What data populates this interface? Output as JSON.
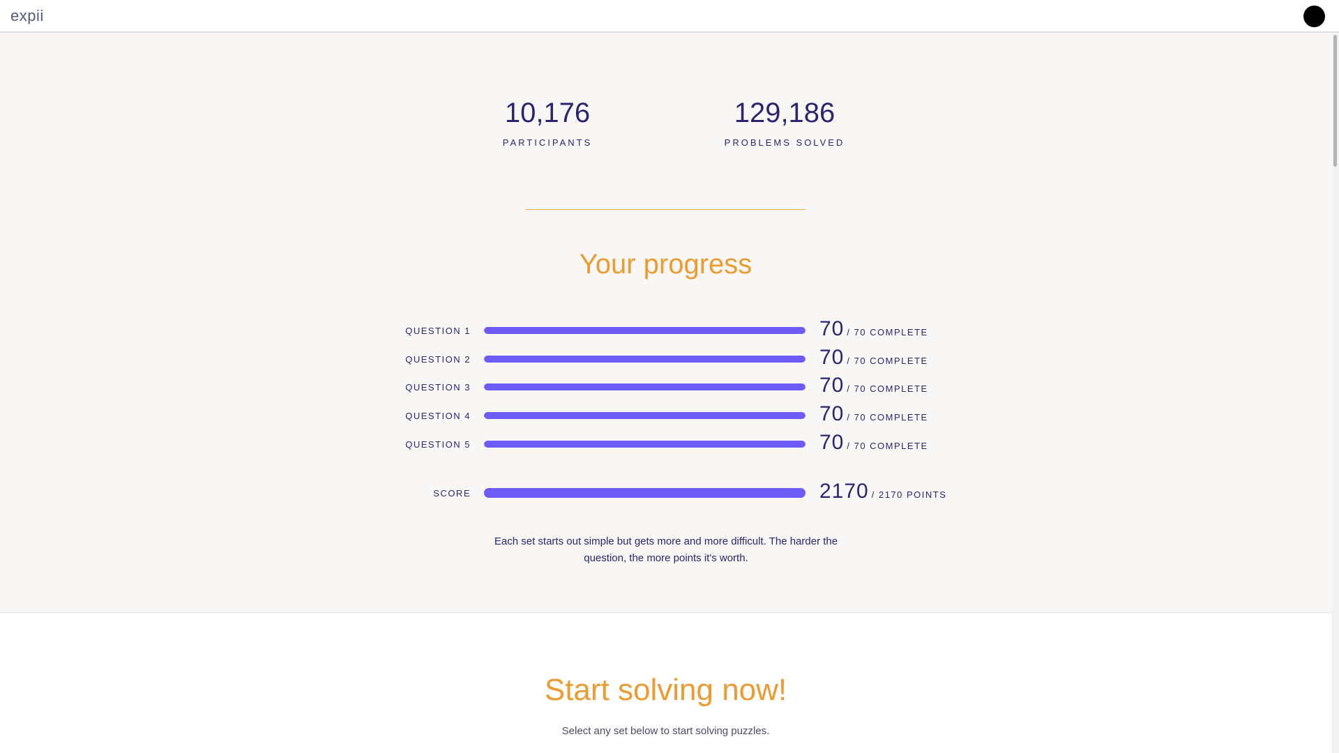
{
  "header": {
    "logo": "expii"
  },
  "stats": [
    {
      "value": "10,176",
      "label": "PARTICIPANTS"
    },
    {
      "value": "129,186",
      "label": "PROBLEMS SOLVED"
    }
  ],
  "progress": {
    "title": "Your progress",
    "rows": [
      {
        "label": "QUESTION 1",
        "value": "70",
        "suffix": "/ 70 COMPLETE",
        "fraction": 1.0
      },
      {
        "label": "QUESTION 2",
        "value": "70",
        "suffix": "/ 70 COMPLETE",
        "fraction": 1.0
      },
      {
        "label": "QUESTION 3",
        "value": "70",
        "suffix": "/ 70 COMPLETE",
        "fraction": 1.0
      },
      {
        "label": "QUESTION 4",
        "value": "70",
        "suffix": "/ 70 COMPLETE",
        "fraction": 1.0
      },
      {
        "label": "QUESTION 5",
        "value": "70",
        "suffix": "/ 70 COMPLETE",
        "fraction": 1.0
      }
    ],
    "score": {
      "label": "SCORE",
      "value": "2170",
      "suffix": "/ 2170 POINTS",
      "fraction": 1.0
    },
    "note": "Each set starts out simple but gets more and more difficult. The harder the question, the more points it's worth."
  },
  "solve": {
    "title": "Start solving now!",
    "subtitle": "Select any set below to start solving puzzles."
  },
  "colors": {
    "accent": "#eb9b2f",
    "bar": "#6e5bf5",
    "text": "#2b2470"
  }
}
